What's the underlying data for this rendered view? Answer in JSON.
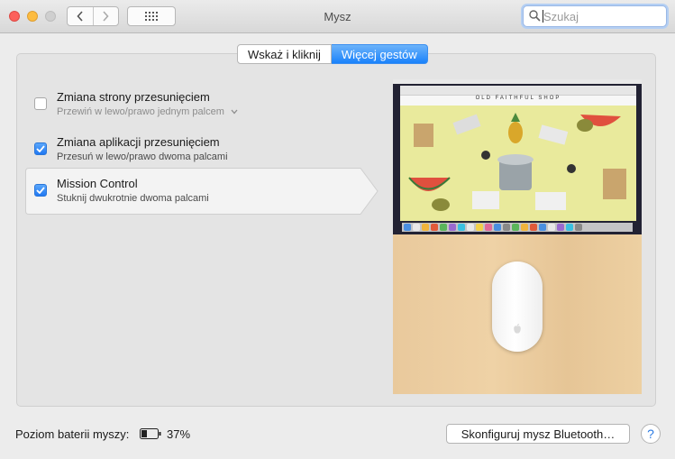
{
  "window": {
    "title": "Mysz"
  },
  "toolbar": {
    "back_icon": "chevron-left-icon",
    "forward_icon": "chevron-right-icon",
    "show_all_icon": "grid-icon",
    "search_placeholder": "Szukaj"
  },
  "tabs": [
    {
      "label": "Wskaż i kliknij",
      "active": false
    },
    {
      "label": "Więcej gestów",
      "active": true
    }
  ],
  "options": [
    {
      "title": "Zmiana strony przesunięciem",
      "subtitle": "Przewiń w lewo/prawo jednym palcem",
      "checked": false,
      "has_dropdown": true
    },
    {
      "title": "Zmiana aplikacji przesunięciem",
      "subtitle": "Przesuń w lewo/prawo dwoma palcami",
      "checked": true
    },
    {
      "title": "Mission Control",
      "subtitle": "Stuknij dwukrotnie dwoma palcami",
      "checked": true,
      "selected": true
    }
  ],
  "preview": {
    "shop_name": "OLD FAITHFUL SHOP"
  },
  "footer": {
    "battery_label": "Poziom baterii myszy:",
    "battery_percent": "37%",
    "battery_level": 0.37,
    "bluetooth_button": "Skonfiguruj mysz Bluetooth…",
    "help": "?"
  },
  "colors": {
    "accent": "#1a82fb",
    "close": "#fc605b",
    "minimize": "#fdbc40"
  }
}
